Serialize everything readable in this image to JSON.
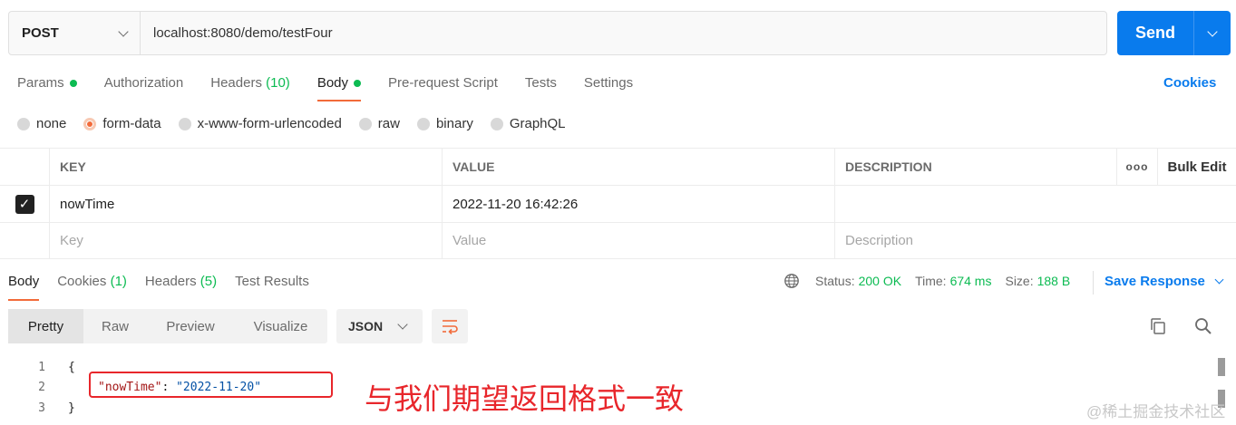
{
  "request": {
    "method": "POST",
    "url": "localhost:8080/demo/testFour",
    "send_label": "Send"
  },
  "req_tabs": [
    {
      "label": "Params",
      "dot": true
    },
    {
      "label": "Authorization"
    },
    {
      "label": "Headers",
      "count": "(10)"
    },
    {
      "label": "Body",
      "dot": true,
      "active": true
    },
    {
      "label": "Pre-request Script"
    },
    {
      "label": "Tests"
    },
    {
      "label": "Settings"
    }
  ],
  "cookies_label": "Cookies",
  "body_types": [
    {
      "label": "none"
    },
    {
      "label": "form-data",
      "selected": true
    },
    {
      "label": "x-www-form-urlencoded"
    },
    {
      "label": "raw"
    },
    {
      "label": "binary"
    },
    {
      "label": "GraphQL"
    }
  ],
  "kv_table": {
    "headers": {
      "key": "KEY",
      "value": "VALUE",
      "description": "DESCRIPTION",
      "more": "ooo",
      "bulk_edit": "Bulk Edit"
    },
    "rows": [
      {
        "checked": true,
        "key": "nowTime",
        "value": "2022-11-20 16:42:26",
        "description": ""
      }
    ],
    "placeholders": {
      "key": "Key",
      "value": "Value",
      "description": "Description"
    }
  },
  "resp_tabs": [
    {
      "label": "Body",
      "active": true
    },
    {
      "label": "Cookies",
      "count": "(1)"
    },
    {
      "label": "Headers",
      "count": "(5)"
    },
    {
      "label": "Test Results"
    }
  ],
  "status": {
    "status_label": "Status:",
    "status_value": "200 OK",
    "time_label": "Time:",
    "time_value": "674 ms",
    "size_label": "Size:",
    "size_value": "188 B"
  },
  "save_response_label": "Save Response",
  "views": [
    "Pretty",
    "Raw",
    "Preview",
    "Visualize"
  ],
  "format": "JSON",
  "code_lines": [
    {
      "n": "1",
      "text": "{"
    },
    {
      "n": "2",
      "key": "\"nowTime\"",
      "sep": ": ",
      "value": "\"2022-11-20\""
    },
    {
      "n": "3",
      "text": "}"
    }
  ],
  "annotation": "与我们期望返回格式一致",
  "watermark": "@稀土掘金技术社区",
  "colors": {
    "accent": "#097bed",
    "active_tab": "#f26b3a",
    "ok_green": "#0cbb52",
    "annotation_red": "#e8262b"
  }
}
